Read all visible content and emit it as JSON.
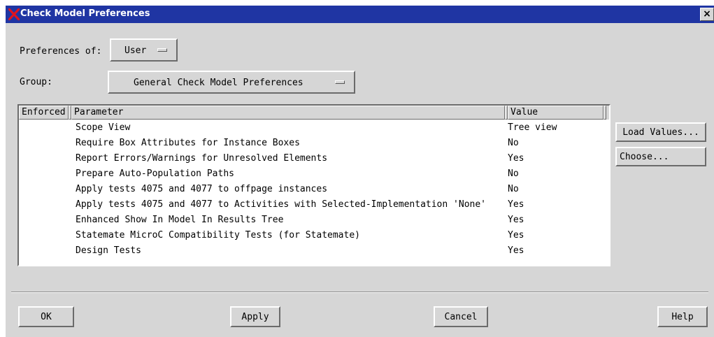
{
  "window": {
    "title": "Check Model Preferences",
    "close_glyph": "×",
    "app_icon": "x-icon"
  },
  "prefs_of": {
    "label": "Preferences of:",
    "value": "User"
  },
  "group": {
    "label": "Group:",
    "value": "General Check Model Preferences"
  },
  "table": {
    "columns": [
      "Enforced",
      "Parameter",
      "Value"
    ],
    "rows": [
      {
        "enforced": "",
        "parameter": "Scope View",
        "value": "Tree view"
      },
      {
        "enforced": "",
        "parameter": "Require Box Attributes for Instance Boxes",
        "value": "No"
      },
      {
        "enforced": "",
        "parameter": "Report Errors/Warnings for Unresolved Elements",
        "value": "Yes"
      },
      {
        "enforced": "",
        "parameter": "Prepare Auto-Population Paths",
        "value": "No"
      },
      {
        "enforced": "",
        "parameter": "Apply tests 4075 and 4077 to offpage instances",
        "value": "No"
      },
      {
        "enforced": "",
        "parameter": "Apply tests 4075 and 4077 to Activities with Selected-Implementation 'None'",
        "value": "Yes"
      },
      {
        "enforced": "",
        "parameter": "Enhanced Show In Model In Results Tree",
        "value": "Yes"
      },
      {
        "enforced": "",
        "parameter": "Statemate MicroC Compatibility Tests (for Statemate)",
        "value": "Yes"
      },
      {
        "enforced": "",
        "parameter": "Design Tests",
        "value": "Yes"
      }
    ]
  },
  "side_buttons": {
    "load_values": "Load Values...",
    "choose": "Choose..."
  },
  "footer": {
    "ok": "OK",
    "apply": "Apply",
    "cancel": "Cancel",
    "help": "Help"
  },
  "colors": {
    "titlebar": "#1f35a3",
    "dialog_bg": "#d6d6d6",
    "list_bg": "#ffffff",
    "icon_red": "#e0141e"
  }
}
